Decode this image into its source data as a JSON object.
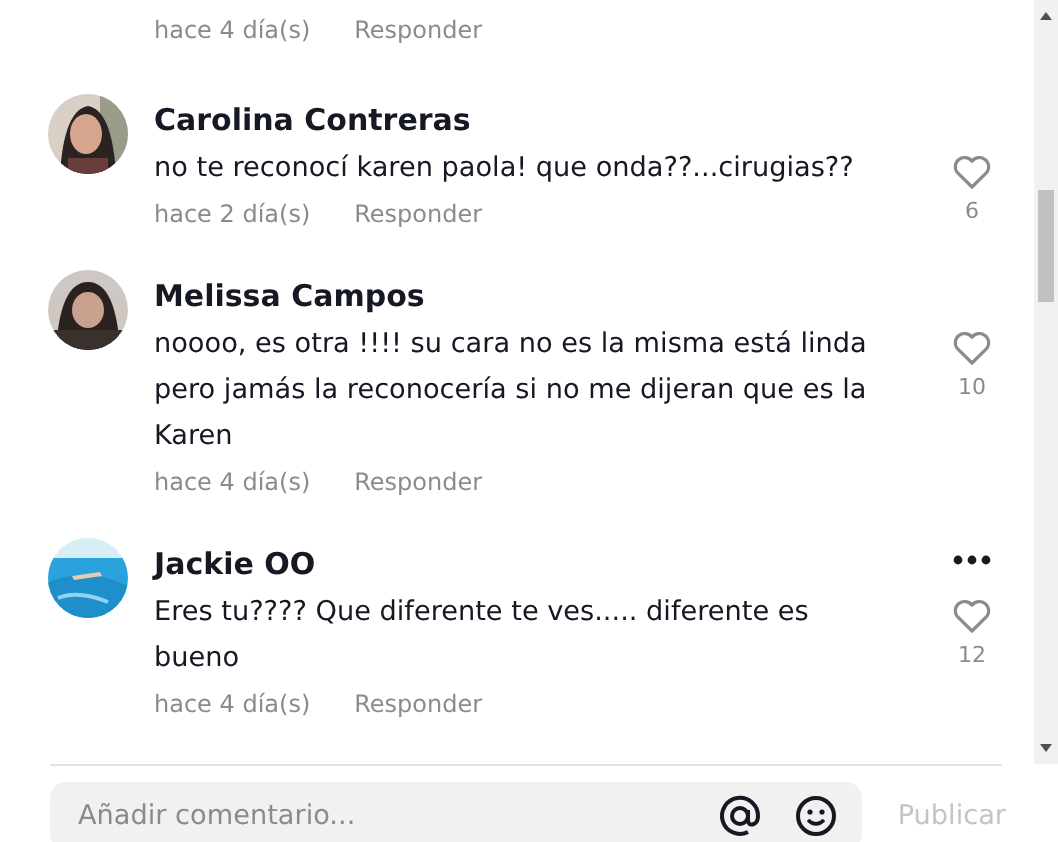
{
  "top_meta": {
    "time": "hace 4 día(s)",
    "reply": "Responder"
  },
  "comments": [
    {
      "author": "Carolina Contreras",
      "text": "no te reconocí karen paola! que onda??...cirugias??",
      "time": "hace 2 día(s)",
      "reply": "Responder",
      "likes": "6",
      "menu": false
    },
    {
      "author": "Melissa Campos",
      "text": "noooo, es otra !!!! su cara no es la misma está linda pero jamás la reconocería si no me dijeran que es la Karen",
      "time": "hace 4 día(s)",
      "reply": "Responder",
      "likes": "10",
      "menu": false
    },
    {
      "author": "Jackie OO",
      "text": "Eres tu???? Que diferente te ves..... diferente es bueno",
      "time": "hace 4 día(s)",
      "reply": "Responder",
      "likes": "12",
      "menu": true
    }
  ],
  "composer": {
    "placeholder": "Añadir comentario...",
    "post": "Publicar"
  }
}
